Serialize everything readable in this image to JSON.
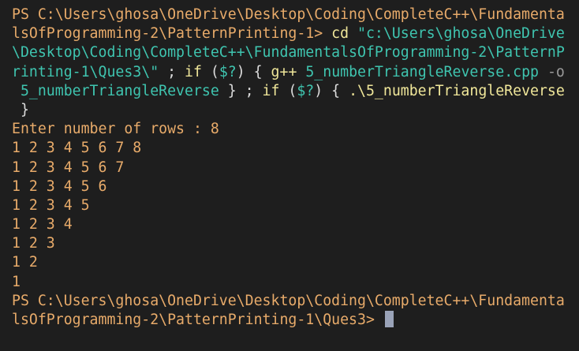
{
  "terminal": {
    "command_lines": [
      [
        {
          "t": "PS C:\\Users\\ghosa\\OneDrive\\Desktop\\Coding\\CompleteC++\\Fundamenta",
          "c": "p"
        }
      ],
      [
        {
          "t": "lsOfProgramming-2\\PatternPrinting-1> ",
          "c": "p"
        },
        {
          "t": "cd ",
          "c": "y"
        },
        {
          "t": "\"c:\\Users\\ghosa\\OneDrive",
          "c": "c"
        }
      ],
      [
        {
          "t": "\\Desktop\\Coding\\CompleteC++\\FundamentalsOfProgramming-2\\PatternP",
          "c": "c"
        }
      ],
      [
        {
          "t": "rinting-1\\Ques3\\\"",
          "c": "c"
        },
        {
          "t": " ; ",
          "c": "w"
        },
        {
          "t": "if",
          "c": "y"
        },
        {
          "t": " (",
          "c": "w"
        },
        {
          "t": "$?",
          "c": "c"
        },
        {
          "t": ") { ",
          "c": "w"
        },
        {
          "t": "g++",
          "c": "y"
        },
        {
          "t": " 5_numberTriangleReverse.cpp ",
          "c": "c"
        },
        {
          "t": "-o",
          "c": "g"
        }
      ],
      [
        {
          "t": " 5_numberTriangleReverse",
          "c": "c"
        },
        {
          "t": " } ; ",
          "c": "w"
        },
        {
          "t": "if",
          "c": "y"
        },
        {
          "t": " (",
          "c": "w"
        },
        {
          "t": "$?",
          "c": "c"
        },
        {
          "t": ") { ",
          "c": "w"
        },
        {
          "t": ".\\5_numberTriangleReverse",
          "c": "y"
        }
      ],
      [
        {
          "t": " }",
          "c": "w"
        }
      ]
    ],
    "output_lines": [
      "Enter number of rows : 8",
      "1 2 3 4 5 6 7 8",
      "1 2 3 4 5 6 7",
      "1 2 3 4 5 6",
      "1 2 3 4 5",
      "1 2 3 4",
      "1 2 3",
      "1 2",
      "1"
    ],
    "final_prompt_lines": [
      "PS C:\\Users\\ghosa\\OneDrive\\Desktop\\Coding\\CompleteC++\\Fundamenta",
      "lsOfProgramming-2\\PatternPrinting-1\\Ques3> "
    ],
    "colors": {
      "background": "#1e1e1e",
      "prompt": "#e8ab6a",
      "keyword": "#f0e79a",
      "string": "#3fc5b0",
      "flag": "#9a9a9a",
      "cursor": "#9aa3b8"
    }
  }
}
